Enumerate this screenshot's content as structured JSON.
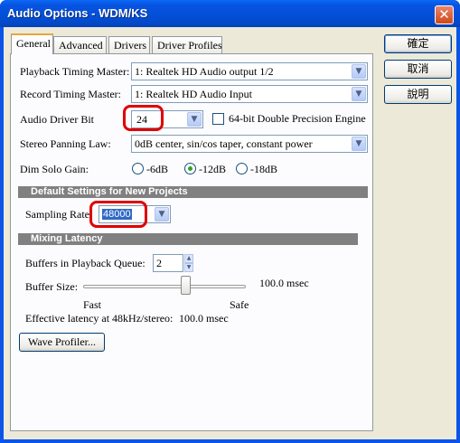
{
  "window": {
    "title": "Audio Options - WDM/KS",
    "close_glyph": "✕"
  },
  "tabs": [
    {
      "label": "General",
      "active": true
    },
    {
      "label": "Advanced"
    },
    {
      "label": "Drivers"
    },
    {
      "label": "Driver Profiles"
    }
  ],
  "buttons": {
    "ok": "確定",
    "cancel": "取消",
    "help": "說明"
  },
  "general": {
    "playback_master": {
      "label": "Playback Timing Master:",
      "value": "1: Realtek HD Audio output 1/2"
    },
    "record_master": {
      "label": "Record Timing Master:",
      "value": "1: Realtek HD Audio Input"
    },
    "driver_bit": {
      "label": "Audio Driver Bit",
      "value": "24"
    },
    "double_precision": {
      "label": "64-bit Double Precision Engine",
      "checked": false
    },
    "panning": {
      "label": "Stereo Panning Law:",
      "value": "0dB center, sin/cos taper, constant power"
    },
    "dim_solo": {
      "label": "Dim Solo Gain:",
      "options": [
        "-6dB",
        "-12dB",
        "-18dB"
      ],
      "selected": "-12dB"
    },
    "defaults_section": "Default Settings for New Projects",
    "sampling_rate": {
      "label": "Sampling Rate:",
      "value": "48000"
    },
    "latency_section": "Mixing Latency",
    "buffers": {
      "label": "Buffers in Playback Queue:",
      "value": "2"
    },
    "buffer_size": {
      "label": "Buffer Size:",
      "readout": "100.0 msec",
      "fast": "Fast",
      "safe": "Safe",
      "slider_fraction": 0.63
    },
    "effective": {
      "label": "Effective latency at 48kHz/stereo:",
      "value": "100.0 msec"
    },
    "wave_profiler": "Wave Profiler..."
  },
  "annotation_color": "#e00000",
  "arrow_glyph": "▼"
}
